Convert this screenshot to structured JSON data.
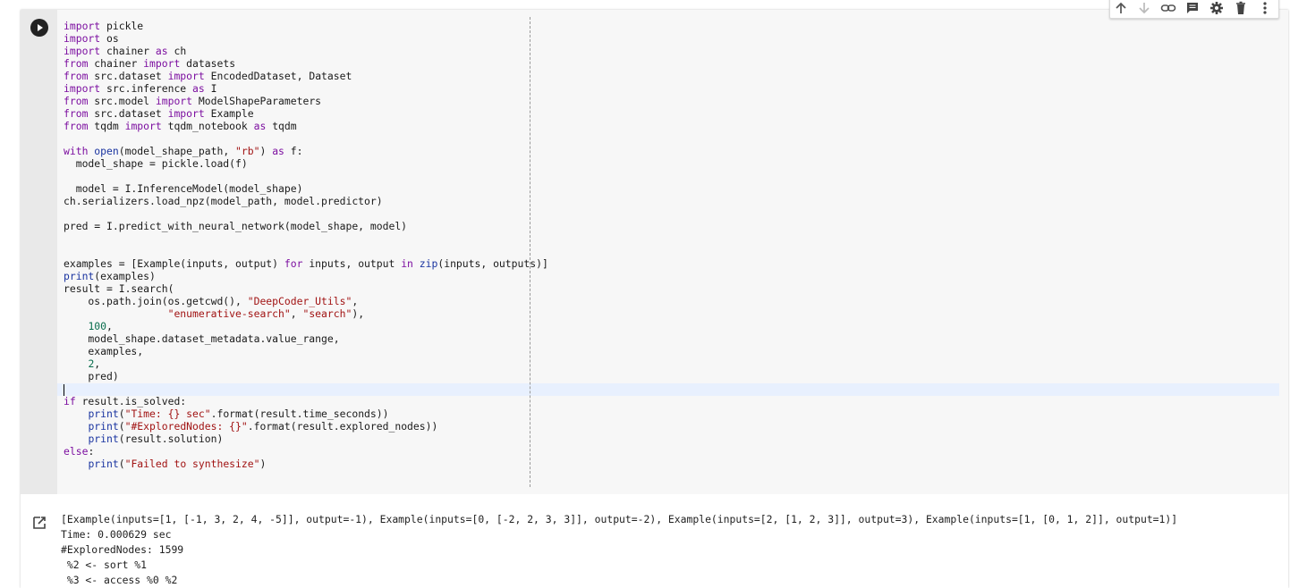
{
  "cell": {
    "run_button_label": "Run cell",
    "code_lines": [
      [
        {
          "t": "import",
          "c": "kw"
        },
        {
          "t": " pickle"
        }
      ],
      [
        {
          "t": "import",
          "c": "kw"
        },
        {
          "t": " os"
        }
      ],
      [
        {
          "t": "import",
          "c": "kw"
        },
        {
          "t": " chainer "
        },
        {
          "t": "as",
          "c": "kw"
        },
        {
          "t": " ch"
        }
      ],
      [
        {
          "t": "from",
          "c": "kw"
        },
        {
          "t": " chainer "
        },
        {
          "t": "import",
          "c": "kw"
        },
        {
          "t": " datasets"
        }
      ],
      [
        {
          "t": "from",
          "c": "kw"
        },
        {
          "t": " src.dataset "
        },
        {
          "t": "import",
          "c": "kw"
        },
        {
          "t": " EncodedDataset, Dataset"
        }
      ],
      [
        {
          "t": "import",
          "c": "kw"
        },
        {
          "t": " src.inference "
        },
        {
          "t": "as",
          "c": "kw"
        },
        {
          "t": " I"
        }
      ],
      [
        {
          "t": "from",
          "c": "kw"
        },
        {
          "t": " src.model "
        },
        {
          "t": "import",
          "c": "kw"
        },
        {
          "t": " ModelShapeParameters"
        }
      ],
      [
        {
          "t": "from",
          "c": "kw"
        },
        {
          "t": " src.dataset "
        },
        {
          "t": "import",
          "c": "kw"
        },
        {
          "t": " Example"
        }
      ],
      [
        {
          "t": "from",
          "c": "kw"
        },
        {
          "t": " tqdm "
        },
        {
          "t": "import",
          "c": "kw"
        },
        {
          "t": " tqdm_notebook "
        },
        {
          "t": "as",
          "c": "kw"
        },
        {
          "t": " tqdm"
        }
      ],
      [],
      [
        {
          "t": "with",
          "c": "kw"
        },
        {
          "t": " "
        },
        {
          "t": "open",
          "c": "bi"
        },
        {
          "t": "(model_shape_path, "
        },
        {
          "t": "\"rb\"",
          "c": "str"
        },
        {
          "t": ") "
        },
        {
          "t": "as",
          "c": "kw"
        },
        {
          "t": " f:"
        }
      ],
      [
        {
          "t": "  model_shape = pickle.load(f)"
        }
      ],
      [],
      [
        {
          "t": "  model = I.InferenceModel(model_shape)"
        }
      ],
      [
        {
          "t": "ch.serializers.load_npz(model_path, model.predictor)"
        }
      ],
      [],
      [
        {
          "t": "pred = I.predict_with_neural_network(model_shape, model)"
        }
      ],
      [],
      [],
      [
        {
          "t": "examples = [Example(inputs, output) "
        },
        {
          "t": "for",
          "c": "kw"
        },
        {
          "t": " inputs, output "
        },
        {
          "t": "in",
          "c": "kw"
        },
        {
          "t": " "
        },
        {
          "t": "zip",
          "c": "bi"
        },
        {
          "t": "(inputs, outputs)]"
        }
      ],
      [
        {
          "t": "print",
          "c": "bi"
        },
        {
          "t": "(examples)"
        }
      ],
      [
        {
          "t": "result = I.search("
        }
      ],
      [
        {
          "t": "    os.path.join(os.getcwd(), "
        },
        {
          "t": "\"DeepCoder_Utils\"",
          "c": "str"
        },
        {
          "t": ","
        }
      ],
      [
        {
          "t": "                 "
        },
        {
          "t": "\"enumerative-search\"",
          "c": "str"
        },
        {
          "t": ", "
        },
        {
          "t": "\"search\"",
          "c": "str"
        },
        {
          "t": "),"
        }
      ],
      [
        {
          "t": "    "
        },
        {
          "t": "100",
          "c": "num"
        },
        {
          "t": ","
        }
      ],
      [
        {
          "t": "    model_shape.dataset_metadata.value_range,"
        }
      ],
      [
        {
          "t": "    examples,"
        }
      ],
      [
        {
          "t": "    "
        },
        {
          "t": "2",
          "c": "num"
        },
        {
          "t": ","
        }
      ],
      [
        {
          "t": "    pred)"
        }
      ],
      [],
      [
        {
          "t": "if",
          "c": "kw"
        },
        {
          "t": " result.is_solved:"
        }
      ],
      [
        {
          "t": "    "
        },
        {
          "t": "print",
          "c": "bi"
        },
        {
          "t": "("
        },
        {
          "t": "\"Time: {} sec\"",
          "c": "str"
        },
        {
          "t": ".format(result.time_seconds))"
        }
      ],
      [
        {
          "t": "    "
        },
        {
          "t": "print",
          "c": "bi"
        },
        {
          "t": "("
        },
        {
          "t": "\"#ExploredNodes: {}\"",
          "c": "str"
        },
        {
          "t": ".format(result.explored_nodes))"
        }
      ],
      [
        {
          "t": "    "
        },
        {
          "t": "print",
          "c": "bi"
        },
        {
          "t": "(result.solution)"
        }
      ],
      [
        {
          "t": "else",
          "c": "kw"
        },
        {
          "t": ":"
        }
      ],
      [
        {
          "t": "    "
        },
        {
          "t": "print",
          "c": "bi"
        },
        {
          "t": "("
        },
        {
          "t": "\"Failed to synthesize\"",
          "c": "str"
        },
        {
          "t": ")"
        }
      ]
    ],
    "toolbar": [
      {
        "name": "move-cell-up-icon"
      },
      {
        "name": "move-cell-down-icon"
      },
      {
        "name": "link-icon"
      },
      {
        "name": "comment-icon"
      },
      {
        "name": "gear-icon"
      },
      {
        "name": "trash-icon"
      },
      {
        "name": "more-vert-icon"
      }
    ]
  },
  "output": {
    "icon": "output-redirect-icon",
    "lines": [
      "[Example(inputs=[1, [-1, 3, 2, 4, -5]], output=-1), Example(inputs=[0, [-2, 2, 3, 3]], output=-2), Example(inputs=[2, [1, 2, 3]], output=3), Example(inputs=[1, [0, 1, 2]], output=1)]",
      "Time: 0.000629 sec",
      "#ExploredNodes: 1599",
      " %2 <- sort %1",
      " %3 <- access %0 %2"
    ]
  },
  "colors": {
    "keyword": "#7c0fa0",
    "builtin": "#1a34a0",
    "string": "#a11313",
    "number": "#0a6e4e",
    "active_line": "#e8f0fe"
  }
}
